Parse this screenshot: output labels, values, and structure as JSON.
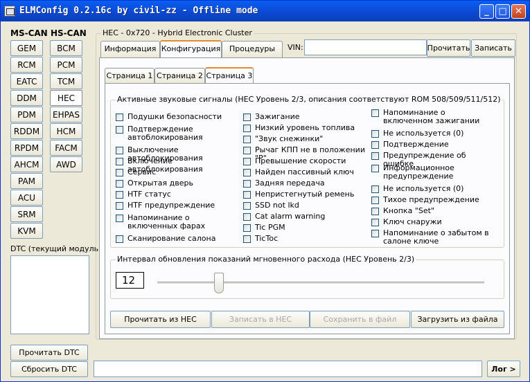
{
  "window": {
    "title": "ELMConfig 0.2.16c by civil-zz - Offline mode"
  },
  "ms_can": {
    "header": "MS-CAN",
    "modules": [
      "GEM",
      "RCM",
      "EATC",
      "DDM",
      "PDM",
      "RDDM",
      "RPDM",
      "AHCM",
      "PAM",
      "ACU",
      "SRM",
      "KVM"
    ]
  },
  "hs_can": {
    "header": "HS-CAN",
    "modules": [
      "BCM",
      "PCM",
      "TCM",
      "HEC",
      "EHPAS",
      "HCM",
      "FACM",
      "AWD"
    ],
    "selected": "HEC"
  },
  "dtc": {
    "label": "DTC (текущий модуль):",
    "read_label": "Прочитать DTC",
    "reset_label": "Сбросить DTC"
  },
  "module_group": {
    "caption": "HEC - 0x720 - Hybrid Electronic Cluster"
  },
  "tabs": [
    "Информация",
    "Конфигурация",
    "Процедуры"
  ],
  "active_tab": "Конфигурация",
  "vin": {
    "label": "VIN:",
    "value": "",
    "read_label": "Прочитать",
    "write_label": "Записать"
  },
  "pages": [
    "Страница 1",
    "Страница 2",
    "Страница 3"
  ],
  "active_page": "Страница 3",
  "sounds": {
    "caption": "Активные звуковые сигналы (HEC Уровень 2/3, описания соответствуют ROM 508/509/511/512)",
    "col1": [
      "Подушки безопасности",
      "Подтверждение автоблокирования",
      "Выключение автоблокирования",
      "Включение автоблокирования",
      "Сервис",
      "Открытая дверь",
      "HTF статус",
      "HTF предупреждение",
      "Напоминание о включенных фарах",
      "Сканирование салона"
    ],
    "col2": [
      "Зажигание",
      "Низкий уровень топлива",
      "\"Звук снежинки\"",
      "Рычаг КПП не в положении \"P\"",
      "Превышение скорости",
      "Найден пассивный ключ",
      "Задняя передача",
      "Непристегнутый ремень",
      "SSD not lkd",
      "Cat alarm warning",
      "Tic PGM",
      "TicToc"
    ],
    "col3": [
      "Напоминание о включенном зажигании",
      "Не используется (0)",
      "Подтверждение",
      "Предупреждение об ошибке",
      "Информационное предупреждение",
      "Не используется (0)",
      "Тихое предупреждение",
      "Кнопка \"Set\"",
      "Ключ снаружи",
      "Напоминание о забытом в салоне ключе"
    ]
  },
  "interval": {
    "caption": "Интервал обновления показаний мгновенного расхода (HEC Уровень 2/3)",
    "value": "12"
  },
  "actions": {
    "read_hec": "Прочитать из HEC",
    "write_hec": "Записать в HEC",
    "save_file": "Сохранить в файл",
    "load_file": "Загрузить из файла"
  },
  "status": {
    "text": "",
    "log_label": "Лог >"
  }
}
